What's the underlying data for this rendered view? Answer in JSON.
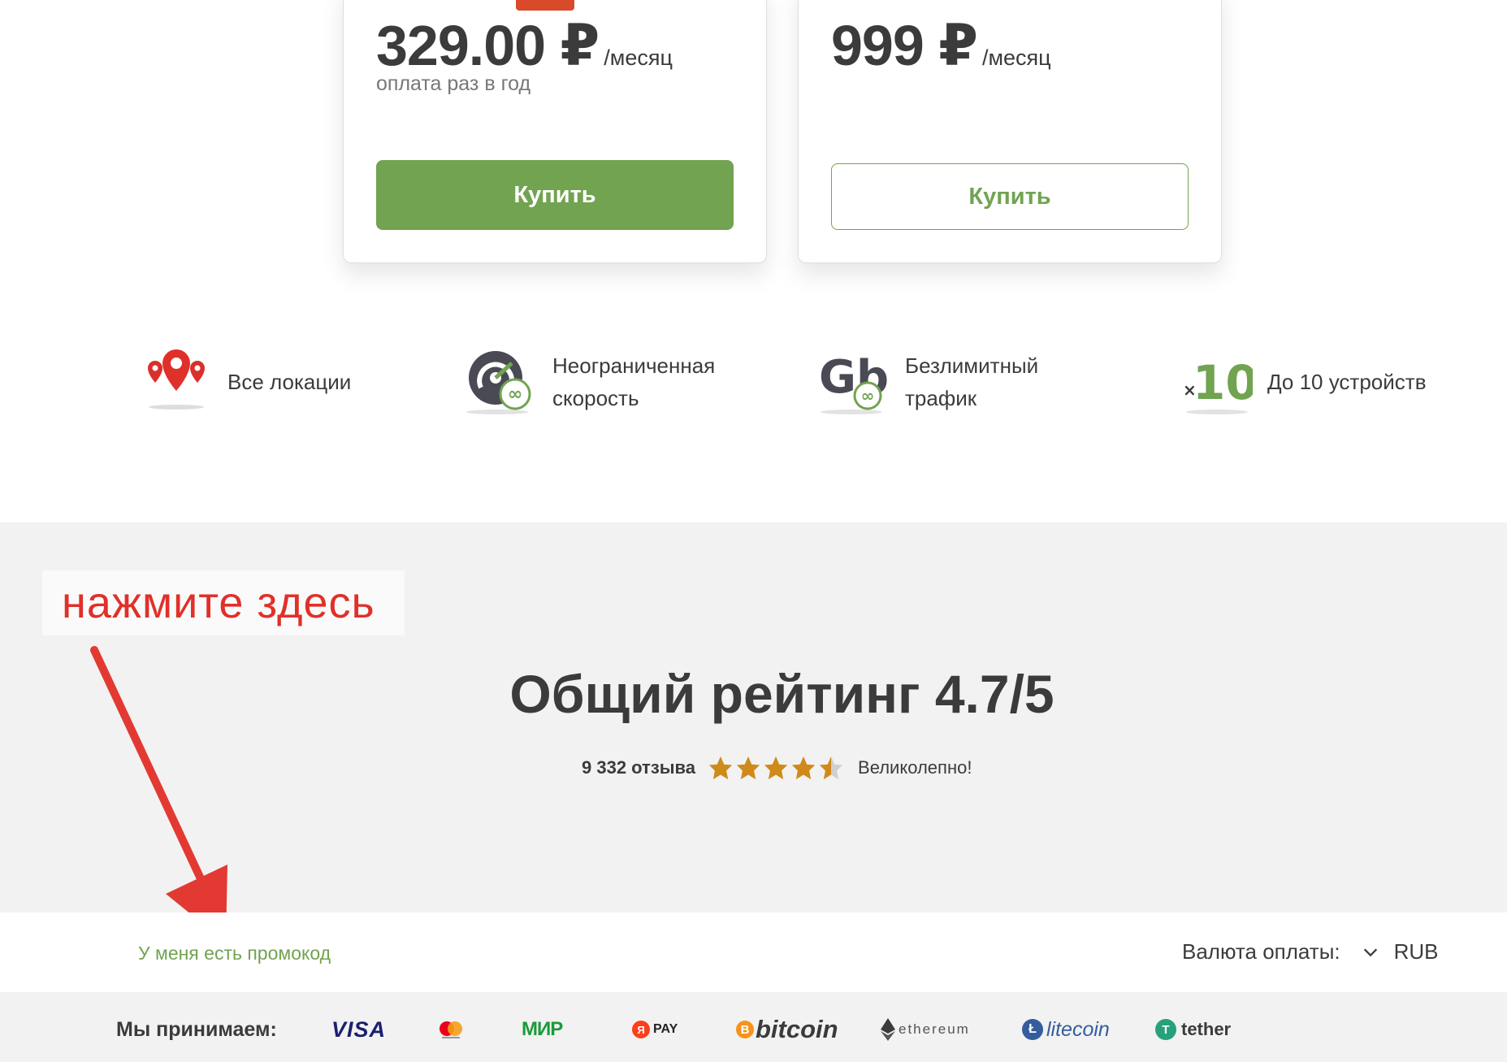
{
  "plans": [
    {
      "price": "329.00 ₽",
      "period": "/месяц",
      "billing_note": "оплата раз в год",
      "buy_label": "Купить",
      "style": "solid"
    },
    {
      "price": "999 ₽",
      "period": "/месяц",
      "billing_note": "",
      "buy_label": "Купить",
      "style": "outline"
    }
  ],
  "features": [
    {
      "icon": "map-pins-icon",
      "label_line1": "Все локации",
      "label_line2": ""
    },
    {
      "icon": "speedometer-infinity-icon",
      "label_line1": "Неограниченная",
      "label_line2": "скорость"
    },
    {
      "icon": "gb-infinity-icon",
      "label_line1": "Безлимитный",
      "label_line2": "трафик"
    },
    {
      "icon": "x10-devices-icon",
      "label_line1": "До 10 устройств",
      "label_line2": ""
    }
  ],
  "annotation": {
    "text": "нажмите здесь"
  },
  "rating": {
    "title": "Общий рейтинг 4.7/5",
    "reviews_count": "9 332 отзыва",
    "stars": 4.5,
    "verdict": "Великолепно!"
  },
  "promo": {
    "link_label": "У меня есть промокод"
  },
  "currency": {
    "label": "Валюта оплаты:",
    "selected": "RUB"
  },
  "payments": {
    "label": "Мы принимаем:",
    "methods": {
      "visa": "VISA",
      "mir": "МИР",
      "ypay_letter": "Я",
      "ypay": "PAY",
      "bitcoin_letter": "B",
      "bitcoin": "bitcoin",
      "ethereum": "ethereum",
      "litecoin_letter": "Ł",
      "litecoin": "litecoin",
      "tether_letter": "T",
      "tether": "tether"
    }
  },
  "colors": {
    "accent_green": "#71a351",
    "annotation_red": "#e0302a",
    "star_gold": "#d08a1a",
    "text_dark": "#3b3b3b"
  }
}
